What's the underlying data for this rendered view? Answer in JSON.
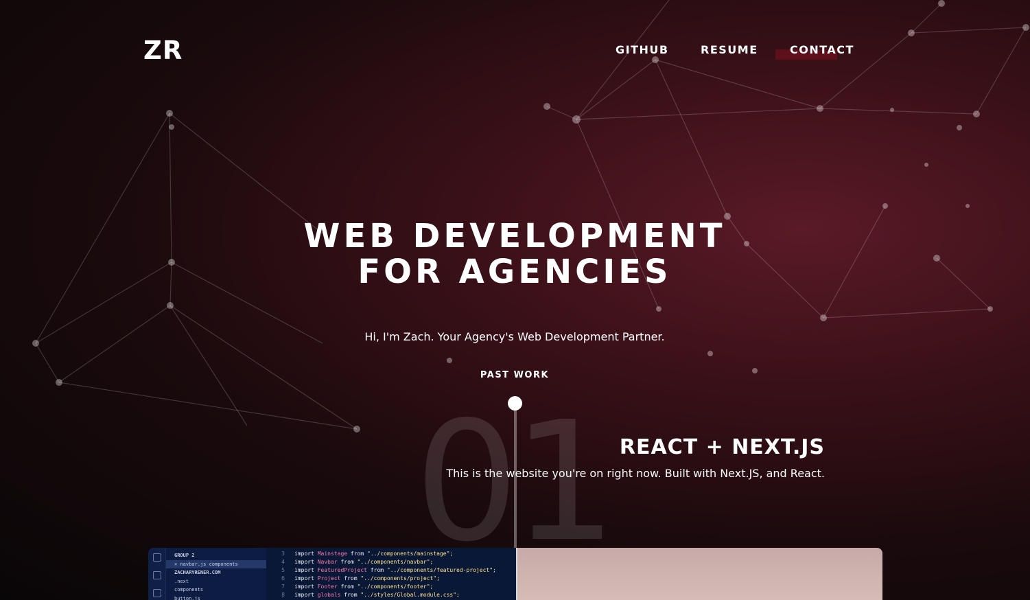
{
  "header": {
    "logo": "ZR",
    "nav": [
      {
        "label": "GITHUB"
      },
      {
        "label": "RESUME"
      },
      {
        "label": "CONTACT"
      }
    ]
  },
  "hero": {
    "title_line1": "WEB DEVELOPMENT",
    "title_line2": "FOR AGENCIES",
    "subtitle": "Hi, I'm Zach. Your Agency's Web Development Partner.",
    "past_work_label": "PAST WORK"
  },
  "project": {
    "number": "01",
    "title": "REACT + NEXT.JS",
    "description": "This is the website you're on right now. Built with Next.JS, and React."
  },
  "editor_preview": {
    "explorer": [
      "GROUP 2",
      "× navbar.js components",
      "ZACHARYRENER.COM",
      ".next",
      "components",
      "button.js"
    ],
    "code_lines": [
      {
        "n": "3",
        "name": "Mainstage",
        "path": "\"../components/mainstage\";"
      },
      {
        "n": "4",
        "name": "Navbar",
        "path": "\"../components/navbar\";"
      },
      {
        "n": "5",
        "name": "FeaturedProject",
        "path": "\"../components/featured-project\";"
      },
      {
        "n": "6",
        "name": "Project",
        "path": "\"../components/project\";"
      },
      {
        "n": "7",
        "name": "Footer",
        "path": "\"../components/footer\";"
      },
      {
        "n": "8",
        "name": "globals",
        "path": "\"../styles/Global.module.css\";"
      }
    ],
    "keyword_import": "import",
    "keyword_from": "from"
  },
  "colors": {
    "accent": "#5e0f1c",
    "background_dark": "#090607",
    "background_glow": "#5a1a26",
    "text": "#ffffff"
  }
}
